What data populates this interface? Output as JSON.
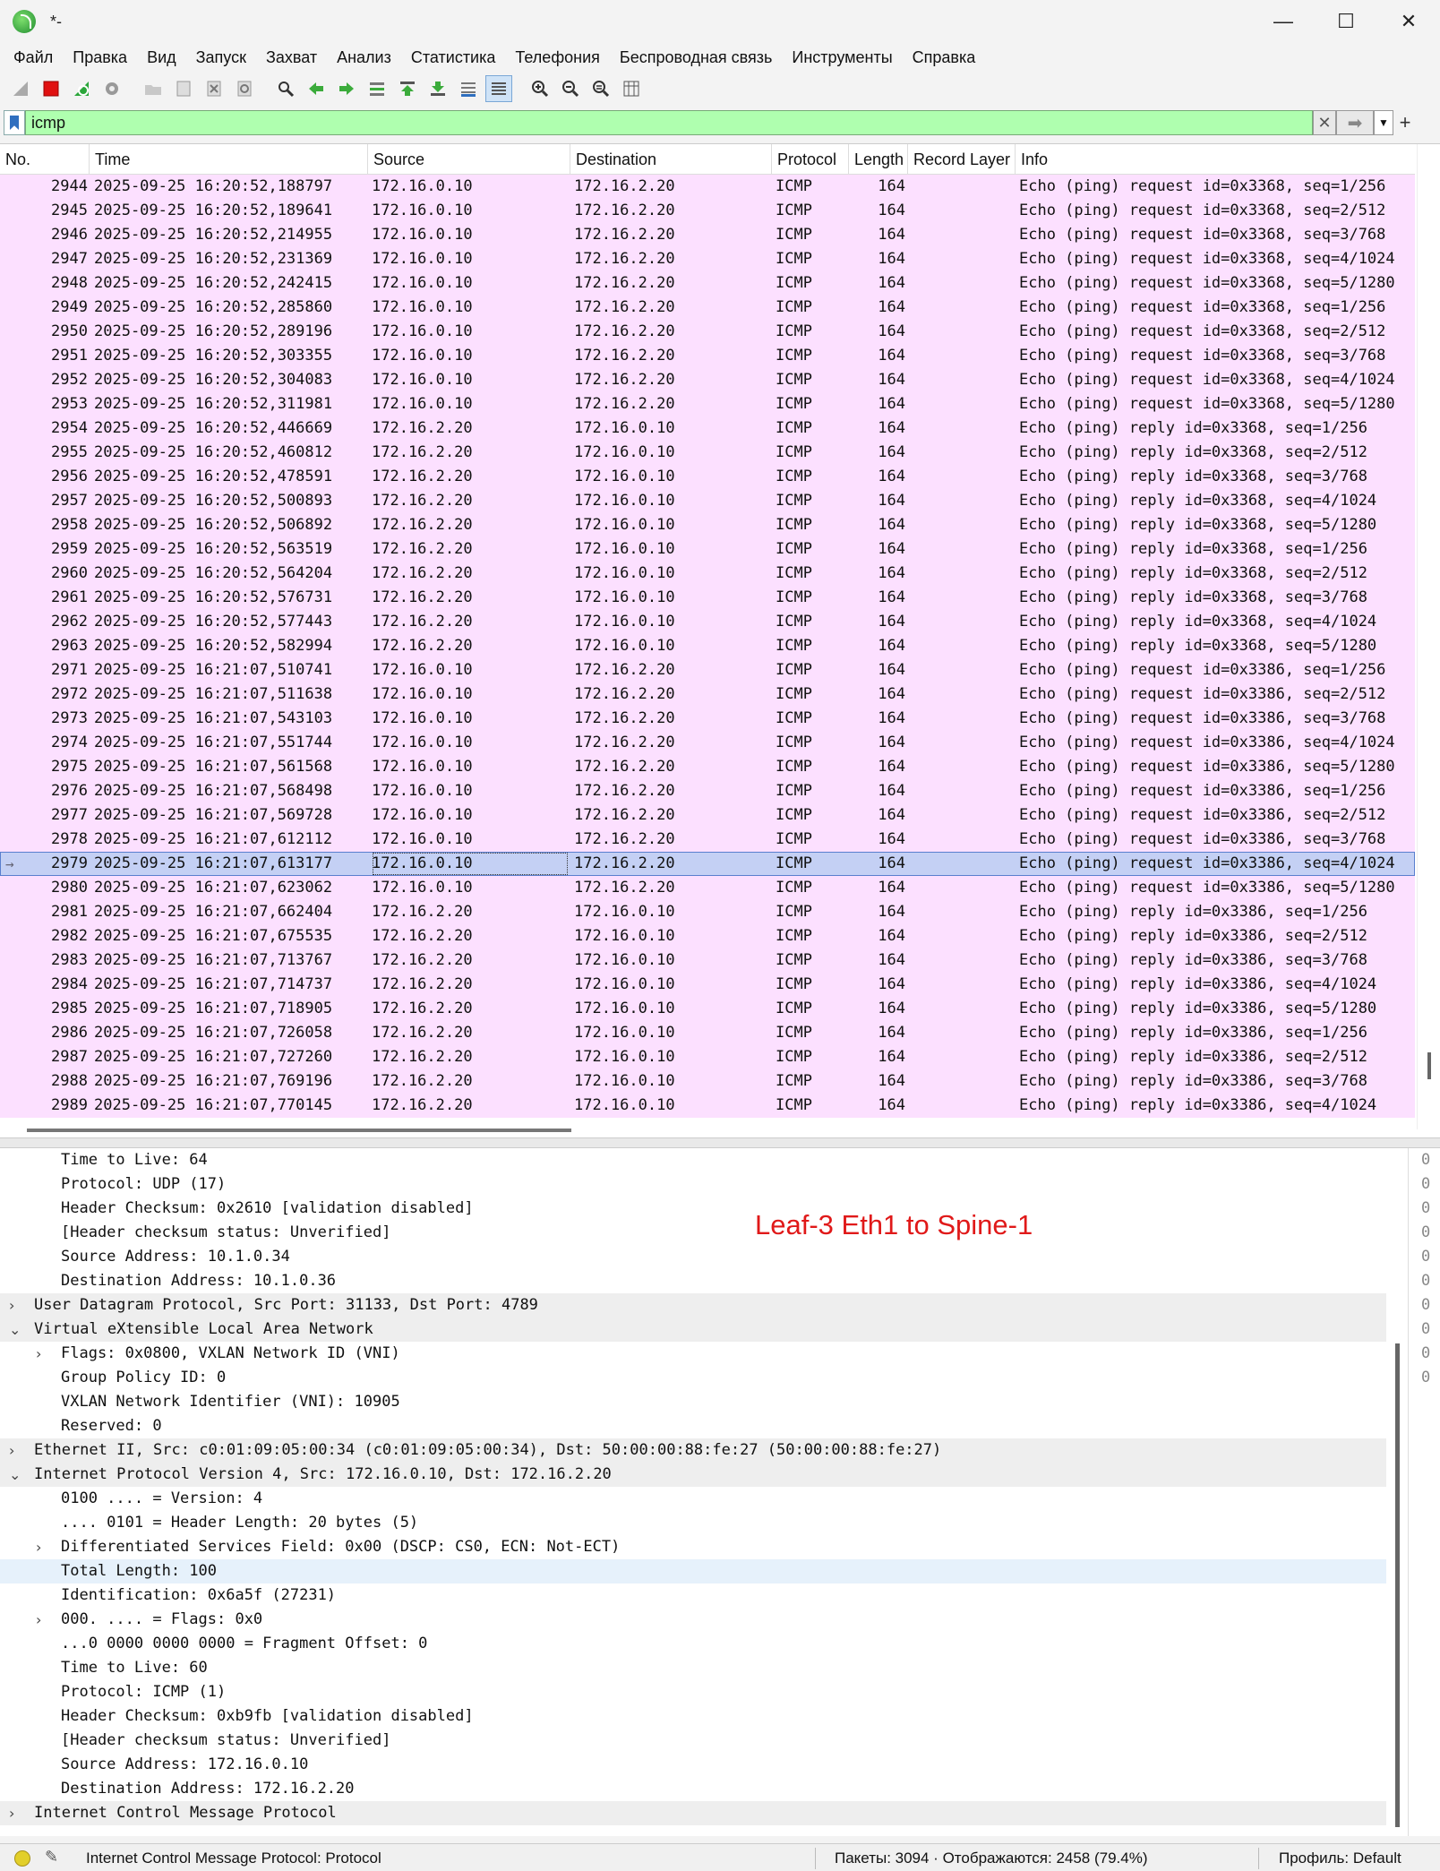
{
  "window": {
    "title": "*-",
    "minimize": "—",
    "maximize": "☐",
    "close": "✕"
  },
  "menu": [
    "Файл",
    "Правка",
    "Вид",
    "Запуск",
    "Захват",
    "Анализ",
    "Статистика",
    "Телефония",
    "Беспроводная связь",
    "Инструменты",
    "Справка"
  ],
  "filter": {
    "value": "icmp"
  },
  "columns": [
    "No.",
    "Time",
    "Source",
    "Destination",
    "Protocol",
    "Length",
    "Record Layer",
    "Info"
  ],
  "packets": [
    {
      "no": "2944",
      "time": "2025-09-25 16:20:52,188797",
      "src": "172.16.0.10",
      "dst": "172.16.2.20",
      "proto": "ICMP",
      "len": "164",
      "info": "Echo (ping) request  id=0x3368, seq=1/256"
    },
    {
      "no": "2945",
      "time": "2025-09-25 16:20:52,189641",
      "src": "172.16.0.10",
      "dst": "172.16.2.20",
      "proto": "ICMP",
      "len": "164",
      "info": "Echo (ping) request  id=0x3368, seq=2/512"
    },
    {
      "no": "2946",
      "time": "2025-09-25 16:20:52,214955",
      "src": "172.16.0.10",
      "dst": "172.16.2.20",
      "proto": "ICMP",
      "len": "164",
      "info": "Echo (ping) request  id=0x3368, seq=3/768"
    },
    {
      "no": "2947",
      "time": "2025-09-25 16:20:52,231369",
      "src": "172.16.0.10",
      "dst": "172.16.2.20",
      "proto": "ICMP",
      "len": "164",
      "info": "Echo (ping) request  id=0x3368, seq=4/1024"
    },
    {
      "no": "2948",
      "time": "2025-09-25 16:20:52,242415",
      "src": "172.16.0.10",
      "dst": "172.16.2.20",
      "proto": "ICMP",
      "len": "164",
      "info": "Echo (ping) request  id=0x3368, seq=5/1280"
    },
    {
      "no": "2949",
      "time": "2025-09-25 16:20:52,285860",
      "src": "172.16.0.10",
      "dst": "172.16.2.20",
      "proto": "ICMP",
      "len": "164",
      "info": "Echo (ping) request  id=0x3368, seq=1/256"
    },
    {
      "no": "2950",
      "time": "2025-09-25 16:20:52,289196",
      "src": "172.16.0.10",
      "dst": "172.16.2.20",
      "proto": "ICMP",
      "len": "164",
      "info": "Echo (ping) request  id=0x3368, seq=2/512"
    },
    {
      "no": "2951",
      "time": "2025-09-25 16:20:52,303355",
      "src": "172.16.0.10",
      "dst": "172.16.2.20",
      "proto": "ICMP",
      "len": "164",
      "info": "Echo (ping) request  id=0x3368, seq=3/768"
    },
    {
      "no": "2952",
      "time": "2025-09-25 16:20:52,304083",
      "src": "172.16.0.10",
      "dst": "172.16.2.20",
      "proto": "ICMP",
      "len": "164",
      "info": "Echo (ping) request  id=0x3368, seq=4/1024"
    },
    {
      "no": "2953",
      "time": "2025-09-25 16:20:52,311981",
      "src": "172.16.0.10",
      "dst": "172.16.2.20",
      "proto": "ICMP",
      "len": "164",
      "info": "Echo (ping) request  id=0x3368, seq=5/1280"
    },
    {
      "no": "2954",
      "time": "2025-09-25 16:20:52,446669",
      "src": "172.16.2.20",
      "dst": "172.16.0.10",
      "proto": "ICMP",
      "len": "164",
      "info": "Echo (ping) reply    id=0x3368, seq=1/256"
    },
    {
      "no": "2955",
      "time": "2025-09-25 16:20:52,460812",
      "src": "172.16.2.20",
      "dst": "172.16.0.10",
      "proto": "ICMP",
      "len": "164",
      "info": "Echo (ping) reply    id=0x3368, seq=2/512"
    },
    {
      "no": "2956",
      "time": "2025-09-25 16:20:52,478591",
      "src": "172.16.2.20",
      "dst": "172.16.0.10",
      "proto": "ICMP",
      "len": "164",
      "info": "Echo (ping) reply    id=0x3368, seq=3/768"
    },
    {
      "no": "2957",
      "time": "2025-09-25 16:20:52,500893",
      "src": "172.16.2.20",
      "dst": "172.16.0.10",
      "proto": "ICMP",
      "len": "164",
      "info": "Echo (ping) reply    id=0x3368, seq=4/1024"
    },
    {
      "no": "2958",
      "time": "2025-09-25 16:20:52,506892",
      "src": "172.16.2.20",
      "dst": "172.16.0.10",
      "proto": "ICMP",
      "len": "164",
      "info": "Echo (ping) reply    id=0x3368, seq=5/1280"
    },
    {
      "no": "2959",
      "time": "2025-09-25 16:20:52,563519",
      "src": "172.16.2.20",
      "dst": "172.16.0.10",
      "proto": "ICMP",
      "len": "164",
      "info": "Echo (ping) reply    id=0x3368, seq=1/256"
    },
    {
      "no": "2960",
      "time": "2025-09-25 16:20:52,564204",
      "src": "172.16.2.20",
      "dst": "172.16.0.10",
      "proto": "ICMP",
      "len": "164",
      "info": "Echo (ping) reply    id=0x3368, seq=2/512"
    },
    {
      "no": "2961",
      "time": "2025-09-25 16:20:52,576731",
      "src": "172.16.2.20",
      "dst": "172.16.0.10",
      "proto": "ICMP",
      "len": "164",
      "info": "Echo (ping) reply    id=0x3368, seq=3/768"
    },
    {
      "no": "2962",
      "time": "2025-09-25 16:20:52,577443",
      "src": "172.16.2.20",
      "dst": "172.16.0.10",
      "proto": "ICMP",
      "len": "164",
      "info": "Echo (ping) reply    id=0x3368, seq=4/1024"
    },
    {
      "no": "2963",
      "time": "2025-09-25 16:20:52,582994",
      "src": "172.16.2.20",
      "dst": "172.16.0.10",
      "proto": "ICMP",
      "len": "164",
      "info": "Echo (ping) reply    id=0x3368, seq=5/1280"
    },
    {
      "no": "2971",
      "time": "2025-09-25 16:21:07,510741",
      "src": "172.16.0.10",
      "dst": "172.16.2.20",
      "proto": "ICMP",
      "len": "164",
      "info": "Echo (ping) request  id=0x3386, seq=1/256"
    },
    {
      "no": "2972",
      "time": "2025-09-25 16:21:07,511638",
      "src": "172.16.0.10",
      "dst": "172.16.2.20",
      "proto": "ICMP",
      "len": "164",
      "info": "Echo (ping) request  id=0x3386, seq=2/512"
    },
    {
      "no": "2973",
      "time": "2025-09-25 16:21:07,543103",
      "src": "172.16.0.10",
      "dst": "172.16.2.20",
      "proto": "ICMP",
      "len": "164",
      "info": "Echo (ping) request  id=0x3386, seq=3/768"
    },
    {
      "no": "2974",
      "time": "2025-09-25 16:21:07,551744",
      "src": "172.16.0.10",
      "dst": "172.16.2.20",
      "proto": "ICMP",
      "len": "164",
      "info": "Echo (ping) request  id=0x3386, seq=4/1024"
    },
    {
      "no": "2975",
      "time": "2025-09-25 16:21:07,561568",
      "src": "172.16.0.10",
      "dst": "172.16.2.20",
      "proto": "ICMP",
      "len": "164",
      "info": "Echo (ping) request  id=0x3386, seq=5/1280"
    },
    {
      "no": "2976",
      "time": "2025-09-25 16:21:07,568498",
      "src": "172.16.0.10",
      "dst": "172.16.2.20",
      "proto": "ICMP",
      "len": "164",
      "info": "Echo (ping) request  id=0x3386, seq=1/256"
    },
    {
      "no": "2977",
      "time": "2025-09-25 16:21:07,569728",
      "src": "172.16.0.10",
      "dst": "172.16.2.20",
      "proto": "ICMP",
      "len": "164",
      "info": "Echo (ping) request  id=0x3386, seq=2/512"
    },
    {
      "no": "2978",
      "time": "2025-09-25 16:21:07,612112",
      "src": "172.16.0.10",
      "dst": "172.16.2.20",
      "proto": "ICMP",
      "len": "164",
      "info": "Echo (ping) request  id=0x3386, seq=3/768"
    },
    {
      "no": "2979",
      "time": "2025-09-25 16:21:07,613177",
      "src": "172.16.0.10",
      "dst": "172.16.2.20",
      "proto": "ICMP",
      "len": "164",
      "info": "Echo (ping) request  id=0x3386, seq=4/1024",
      "selected": true
    },
    {
      "no": "2980",
      "time": "2025-09-25 16:21:07,623062",
      "src": "172.16.0.10",
      "dst": "172.16.2.20",
      "proto": "ICMP",
      "len": "164",
      "info": "Echo (ping) request  id=0x3386, seq=5/1280"
    },
    {
      "no": "2981",
      "time": "2025-09-25 16:21:07,662404",
      "src": "172.16.2.20",
      "dst": "172.16.0.10",
      "proto": "ICMP",
      "len": "164",
      "info": "Echo (ping) reply    id=0x3386, seq=1/256"
    },
    {
      "no": "2982",
      "time": "2025-09-25 16:21:07,675535",
      "src": "172.16.2.20",
      "dst": "172.16.0.10",
      "proto": "ICMP",
      "len": "164",
      "info": "Echo (ping) reply    id=0x3386, seq=2/512"
    },
    {
      "no": "2983",
      "time": "2025-09-25 16:21:07,713767",
      "src": "172.16.2.20",
      "dst": "172.16.0.10",
      "proto": "ICMP",
      "len": "164",
      "info": "Echo (ping) reply    id=0x3386, seq=3/768"
    },
    {
      "no": "2984",
      "time": "2025-09-25 16:21:07,714737",
      "src": "172.16.2.20",
      "dst": "172.16.0.10",
      "proto": "ICMP",
      "len": "164",
      "info": "Echo (ping) reply    id=0x3386, seq=4/1024"
    },
    {
      "no": "2985",
      "time": "2025-09-25 16:21:07,718905",
      "src": "172.16.2.20",
      "dst": "172.16.0.10",
      "proto": "ICMP",
      "len": "164",
      "info": "Echo (ping) reply    id=0x3386, seq=5/1280"
    },
    {
      "no": "2986",
      "time": "2025-09-25 16:21:07,726058",
      "src": "172.16.2.20",
      "dst": "172.16.0.10",
      "proto": "ICMP",
      "len": "164",
      "info": "Echo (ping) reply    id=0x3386, seq=1/256"
    },
    {
      "no": "2987",
      "time": "2025-09-25 16:21:07,727260",
      "src": "172.16.2.20",
      "dst": "172.16.0.10",
      "proto": "ICMP",
      "len": "164",
      "info": "Echo (ping) reply    id=0x3386, seq=2/512"
    },
    {
      "no": "2988",
      "time": "2025-09-25 16:21:07,769196",
      "src": "172.16.2.20",
      "dst": "172.16.0.10",
      "proto": "ICMP",
      "len": "164",
      "info": "Echo (ping) reply    id=0x3386, seq=3/768"
    },
    {
      "no": "2989",
      "time": "2025-09-25 16:21:07,770145",
      "src": "172.16.2.20",
      "dst": "172.16.0.10",
      "proto": "ICMP",
      "len": "164",
      "info": "Echo (ping) reply    id=0x3386, seq=4/1024"
    }
  ],
  "details": [
    {
      "level": 1,
      "text": "Time to Live: 64"
    },
    {
      "level": 1,
      "text": "Protocol: UDP (17)"
    },
    {
      "level": 1,
      "text": "Header Checksum: 0x2610 [validation disabled]"
    },
    {
      "level": 1,
      "text": "[Header checksum status: Unverified]"
    },
    {
      "level": 1,
      "text": "Source Address: 10.1.0.34"
    },
    {
      "level": 1,
      "text": "Destination Address: 10.1.0.36"
    },
    {
      "level": 0,
      "arrow": "›",
      "text": "User Datagram Protocol, Src Port: 31133, Dst Port: 4789"
    },
    {
      "level": 0,
      "arrow": "⌄",
      "text": "Virtual eXtensible Local Area Network"
    },
    {
      "level": 1,
      "arrow": "›",
      "text": "Flags: 0x0800, VXLAN Network ID (VNI)"
    },
    {
      "level": 1,
      "text": "Group Policy ID: 0"
    },
    {
      "level": 1,
      "text": "VXLAN Network Identifier (VNI): 10905"
    },
    {
      "level": 1,
      "text": "Reserved: 0"
    },
    {
      "level": 0,
      "arrow": "›",
      "text": "Ethernet II, Src: c0:01:09:05:00:34 (c0:01:09:05:00:34), Dst: 50:00:00:88:fe:27 (50:00:00:88:fe:27)"
    },
    {
      "level": 0,
      "arrow": "⌄",
      "text": "Internet Protocol Version 4, Src: 172.16.0.10, Dst: 172.16.2.20"
    },
    {
      "level": 1,
      "text": "0100 .... = Version: 4"
    },
    {
      "level": 1,
      "text": ".... 0101 = Header Length: 20 bytes (5)"
    },
    {
      "level": 1,
      "arrow": "›",
      "text": "Differentiated Services Field: 0x00 (DSCP: CS0, ECN: Not-ECT)"
    },
    {
      "level": 1,
      "text": "Total Length: 100",
      "highlight": true
    },
    {
      "level": 1,
      "text": "Identification: 0x6a5f (27231)"
    },
    {
      "level": 1,
      "arrow": "›",
      "text": "000. .... = Flags: 0x0"
    },
    {
      "level": 1,
      "text": "...0 0000 0000 0000 = Fragment Offset: 0"
    },
    {
      "level": 1,
      "text": "Time to Live: 60"
    },
    {
      "level": 1,
      "text": "Protocol: ICMP (1)"
    },
    {
      "level": 1,
      "text": "Header Checksum: 0xb9fb [validation disabled]"
    },
    {
      "level": 1,
      "text": "[Header checksum status: Unverified]"
    },
    {
      "level": 1,
      "text": "Source Address: 172.16.0.10"
    },
    {
      "level": 1,
      "text": "Destination Address: 172.16.2.20"
    },
    {
      "level": 0,
      "arrow": "›",
      "text": "Internet Control Message Protocol"
    }
  ],
  "annotation": "Leaf-3 Eth1 to Spine-1",
  "bytes_col": [
    "0",
    "0",
    "0",
    "0",
    "0",
    "0",
    "0",
    "0",
    "0",
    "0"
  ],
  "status": {
    "left": "Internet Control Message Protocol: Protocol",
    "mid": "Пакеты: 3094 · Отображаются: 2458 (79.4%)",
    "right": "Профиль: Default"
  }
}
